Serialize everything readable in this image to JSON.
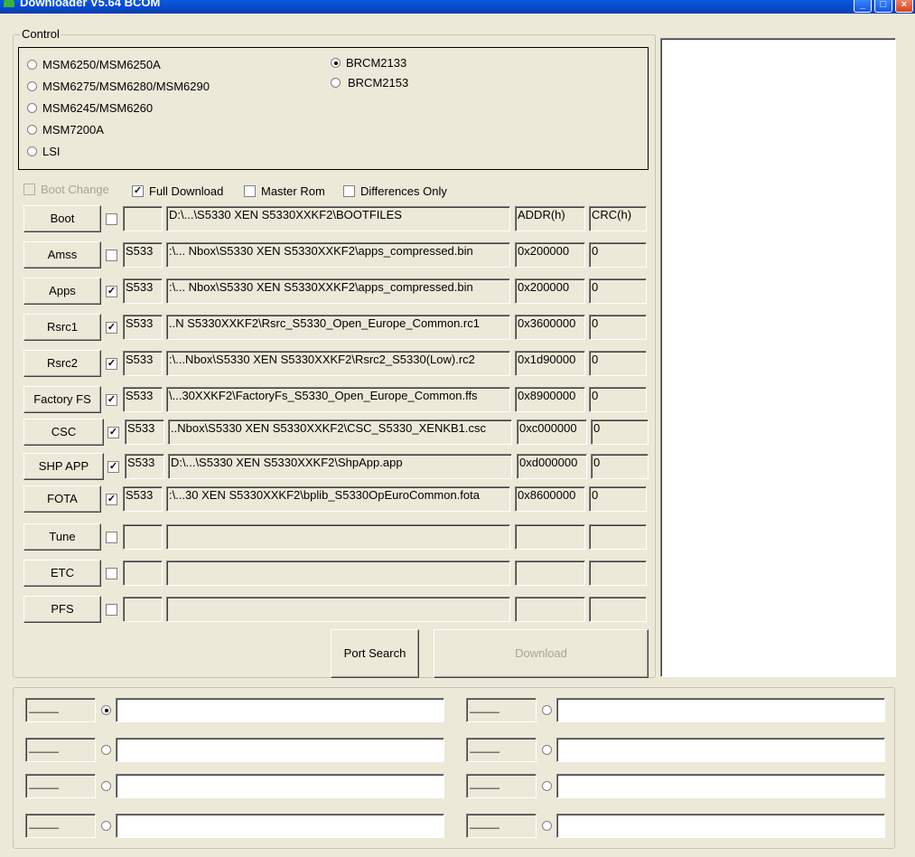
{
  "window": {
    "title": "Downloader V5.64 BCOM"
  },
  "control": {
    "legend": "Control",
    "chips_left": [
      "MSM6250/MSM6250A",
      "MSM6275/MSM6280/MSM6290",
      "MSM6245/MSM6260",
      "MSM7200A",
      "LSI"
    ],
    "chips_right": [
      "BRCM2133",
      "BRCM2153"
    ],
    "selected_chip": "BRCM2133"
  },
  "options": {
    "boot_change": {
      "label": "Boot Change",
      "checked": false,
      "enabled": false
    },
    "full_download": {
      "label": "Full Download",
      "checked": true
    },
    "master_rom": {
      "label": "Master Rom",
      "checked": false
    },
    "differences_only": {
      "label": "Differences Only",
      "checked": false
    }
  },
  "headers": {
    "addr": "ADDR(h)",
    "crc": "CRC(h)"
  },
  "rows": [
    {
      "button": "Boot",
      "checked": false,
      "short": "",
      "path": "D:\\...\\S5330 XEN S5330XXKF2\\BOOTFILES",
      "addr": "ADDR(h)",
      "crc": "CRC(h)"
    },
    {
      "button": "Amss",
      "checked": false,
      "short": "S533",
      "path": ":\\... Nbox\\S5330 XEN S5330XXKF2\\apps_compressed.bin",
      "addr": "0x200000",
      "crc": "0"
    },
    {
      "button": "Apps",
      "checked": true,
      "short": "S533",
      "path": ":\\... Nbox\\S5330 XEN S5330XXKF2\\apps_compressed.bin",
      "addr": "0x200000",
      "crc": "0"
    },
    {
      "button": "Rsrc1",
      "checked": true,
      "short": "S533",
      "path": "..N S5330XXKF2\\Rsrc_S5330_Open_Europe_Common.rc1",
      "addr": "0x3600000",
      "crc": "0"
    },
    {
      "button": "Rsrc2",
      "checked": true,
      "short": "S533",
      "path": ":\\...Nbox\\S5330 XEN S5330XXKF2\\Rsrc2_S5330(Low).rc2",
      "addr": "0x1d90000",
      "crc": "0"
    },
    {
      "button": "Factory FS",
      "checked": true,
      "short": "S533",
      "path": "\\...30XXKF2\\FactoryFs_S5330_Open_Europe_Common.ffs",
      "addr": "0x8900000",
      "crc": "0"
    },
    {
      "button": "CSC",
      "checked": true,
      "short": "S533",
      "path": "..Nbox\\S5330 XEN S5330XXKF2\\CSC_S5330_XENKB1.csc",
      "addr": "0xc000000",
      "crc": "0"
    },
    {
      "button": "SHP APP",
      "checked": true,
      "short": "S533",
      "path": "D:\\...\\S5330 XEN S5330XXKF2\\ShpApp.app",
      "addr": "0xd000000",
      "crc": "0"
    },
    {
      "button": "FOTA",
      "checked": true,
      "short": "S533",
      "path": ":\\...30 XEN S5330XXKF2\\bplib_S5330OpEuroCommon.fota",
      "addr": "0x8600000",
      "crc": "0"
    },
    {
      "button": "Tune",
      "checked": false,
      "short": "",
      "path": "",
      "addr": "",
      "crc": ""
    },
    {
      "button": "ETC",
      "checked": false,
      "short": "",
      "path": "",
      "addr": "",
      "crc": ""
    },
    {
      "button": "PFS",
      "checked": false,
      "short": "",
      "path": "",
      "addr": "",
      "crc": ""
    }
  ],
  "actions": {
    "port_search": "Port Search",
    "download": "Download"
  },
  "ports": {
    "label_text": "———",
    "selected_index": 0,
    "count": 8
  }
}
